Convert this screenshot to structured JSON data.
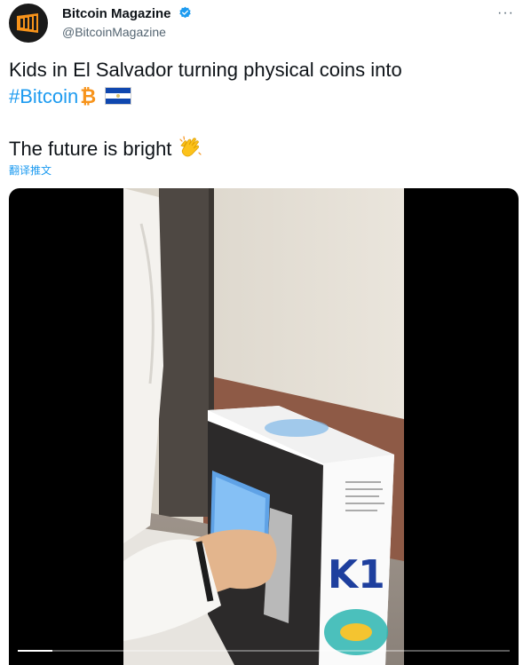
{
  "account": {
    "display_name": "Bitcoin Magazine",
    "handle": "@BitcoinMagazine",
    "verified": true
  },
  "menu": {
    "more_label": "···"
  },
  "tweet": {
    "line1": "Kids in El Salvador turning physical coins into",
    "hashtag": "#Bitcoin",
    "line3": "The future is bright",
    "translate_label": "翻译推文"
  },
  "video_overlay": {
    "machine_brand": "K1",
    "progress": 0.07
  },
  "icons": {
    "bitcoin": "bitcoin-emoji",
    "flag": "el-salvador-flag-emoji",
    "clap": "clapping-hands-emoji",
    "verified": "verified-badge-icon"
  },
  "colors": {
    "accent": "#1d9bf0",
    "bitcoin_orange": "#f7931a",
    "flag_blue": "#0f47af"
  }
}
